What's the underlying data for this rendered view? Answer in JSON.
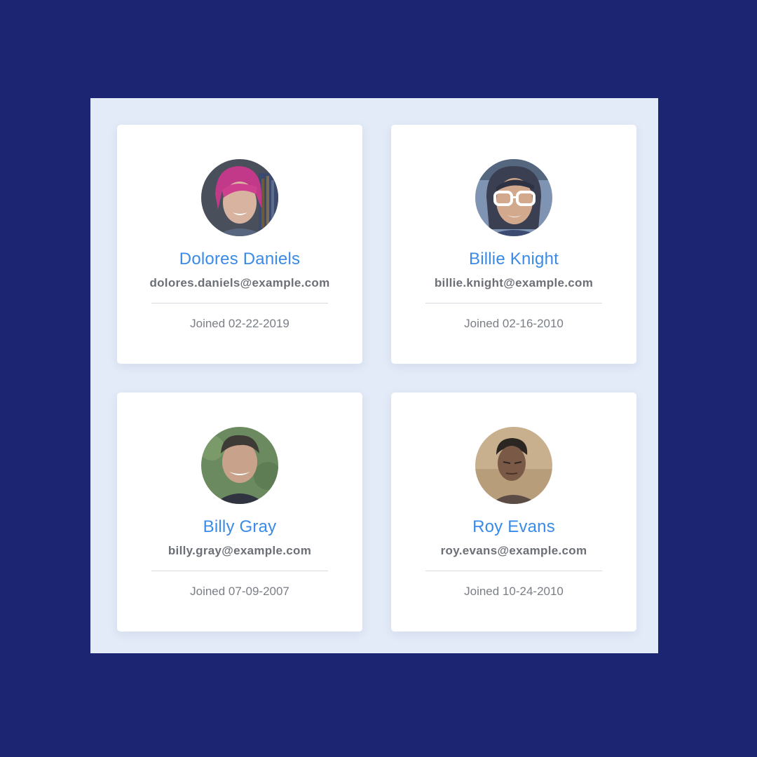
{
  "users": [
    {
      "name": "Dolores Daniels",
      "email": "dolores.daniels@example.com",
      "joined": "Joined 02-22-2019"
    },
    {
      "name": "Billie Knight",
      "email": "billie.knight@example.com",
      "joined": "Joined 02-16-2010"
    },
    {
      "name": "Billy Gray",
      "email": "billy.gray@example.com",
      "joined": "Joined 07-09-2007"
    },
    {
      "name": "Roy Evans",
      "email": "roy.evans@example.com",
      "joined": "Joined 10-24-2010"
    }
  ],
  "colors": {
    "page_background": "#1b2572",
    "panel_background": "#e3ebf8",
    "card_background": "#ffffff",
    "name_color": "#3a8ae8",
    "email_color": "#6b6f76",
    "joined_color": "#7a7e85"
  }
}
